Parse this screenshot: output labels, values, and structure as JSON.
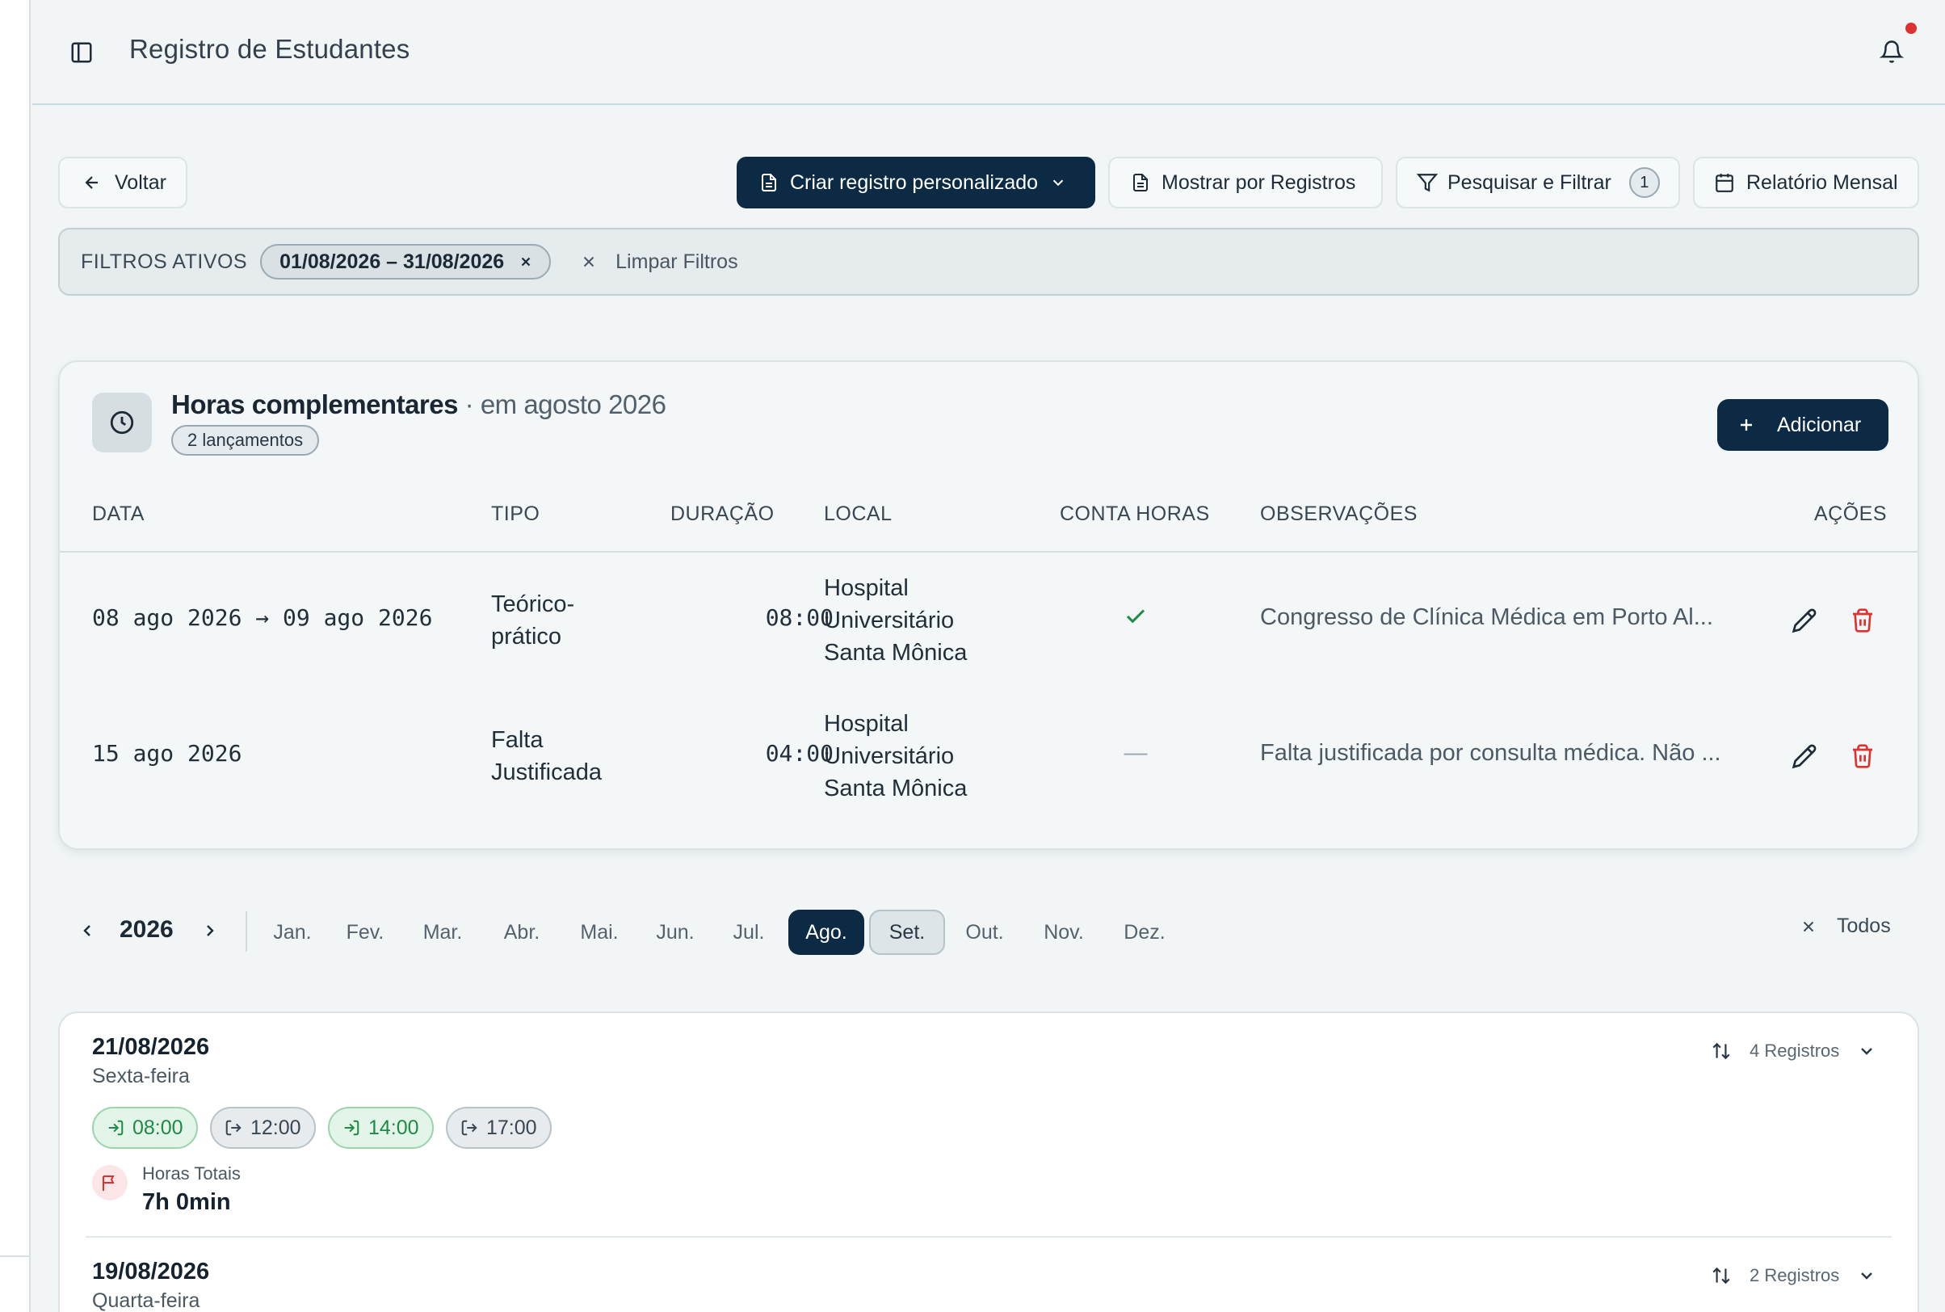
{
  "header": {
    "title": "Registro de Estudantes",
    "notification_dot": true
  },
  "toolbar": {
    "back_label": "Voltar",
    "create_label": "Criar registro personalizado",
    "show_label": "Mostrar por Registros",
    "search_label": "Pesquisar e Filtrar",
    "search_count": "1",
    "report_label": "Relatório Mensal"
  },
  "filters": {
    "label": "FILTROS ATIVOS",
    "chip": "01/08/2026 – 31/08/2026",
    "clear_label": "Limpar Filtros"
  },
  "complementary": {
    "title": "Horas complementares",
    "subtitle": "· em agosto 2026",
    "count": "2 lançamentos",
    "add_label": "Adicionar",
    "columns": [
      "DATA",
      "TIPO",
      "DURAÇÃO",
      "LOCAL",
      "CONTA HORAS",
      "OBSERVAÇÕES",
      "AÇÕES"
    ],
    "rows": [
      {
        "date": "08 ago 2026 → 09 ago 2026",
        "type_line1": "Teórico-",
        "type_line2": "prático",
        "duration": "08:00",
        "local_line1": "Hospital",
        "local_line2": "Universitário",
        "local_line3": "Santa Mônica",
        "counts_hours": "check",
        "obs": "Congresso de Clínica Médica em Porto Al..."
      },
      {
        "date": "15 ago 2026",
        "type_line1": "Falta",
        "type_line2": "Justificada",
        "duration": "04:00",
        "local_line1": "Hospital",
        "local_line2": "Universitário",
        "local_line3": "Santa Mônica",
        "counts_hours": "—",
        "obs": "Falta justificada por consulta médica. Não ..."
      }
    ]
  },
  "months": {
    "year": "2026",
    "items": [
      "Jan.",
      "Fev.",
      "Mar.",
      "Abr.",
      "Mai.",
      "Jun.",
      "Jul.",
      "Ago.",
      "Set.",
      "Out.",
      "Nov.",
      "Dez."
    ],
    "active": "Ago.",
    "highlighted": "Set.",
    "all_label": "Todos"
  },
  "days": [
    {
      "date": "21/08/2026",
      "weekday": "Sexta-feira",
      "records": "4 Registros",
      "times": [
        "08:00",
        "12:00",
        "14:00",
        "17:00"
      ],
      "total_label": "Horas Totais",
      "total_value": "7h 0min"
    },
    {
      "date": "19/08/2026",
      "weekday": "Quarta-feira",
      "records": "2 Registros"
    }
  ],
  "colors": {
    "primary": "#0c2a44",
    "success": "#1f8a46",
    "danger": "#e03131",
    "background": "#f1f5f6"
  }
}
